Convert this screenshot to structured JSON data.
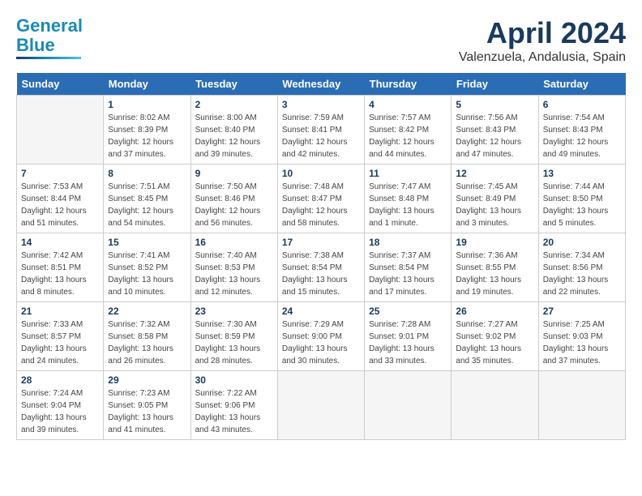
{
  "header": {
    "logo_line1": "General",
    "logo_line2": "Blue",
    "month": "April 2024",
    "location": "Valenzuela, Andalusia, Spain"
  },
  "days_of_week": [
    "Sunday",
    "Monday",
    "Tuesday",
    "Wednesday",
    "Thursday",
    "Friday",
    "Saturday"
  ],
  "weeks": [
    [
      {
        "num": "",
        "empty": true
      },
      {
        "num": "1",
        "sunrise": "8:02 AM",
        "sunset": "8:39 PM",
        "daylight": "12 hours and 37 minutes."
      },
      {
        "num": "2",
        "sunrise": "8:00 AM",
        "sunset": "8:40 PM",
        "daylight": "12 hours and 39 minutes."
      },
      {
        "num": "3",
        "sunrise": "7:59 AM",
        "sunset": "8:41 PM",
        "daylight": "12 hours and 42 minutes."
      },
      {
        "num": "4",
        "sunrise": "7:57 AM",
        "sunset": "8:42 PM",
        "daylight": "12 hours and 44 minutes."
      },
      {
        "num": "5",
        "sunrise": "7:56 AM",
        "sunset": "8:43 PM",
        "daylight": "12 hours and 47 minutes."
      },
      {
        "num": "6",
        "sunrise": "7:54 AM",
        "sunset": "8:43 PM",
        "daylight": "12 hours and 49 minutes."
      }
    ],
    [
      {
        "num": "7",
        "sunrise": "7:53 AM",
        "sunset": "8:44 PM",
        "daylight": "12 hours and 51 minutes."
      },
      {
        "num": "8",
        "sunrise": "7:51 AM",
        "sunset": "8:45 PM",
        "daylight": "12 hours and 54 minutes."
      },
      {
        "num": "9",
        "sunrise": "7:50 AM",
        "sunset": "8:46 PM",
        "daylight": "12 hours and 56 minutes."
      },
      {
        "num": "10",
        "sunrise": "7:48 AM",
        "sunset": "8:47 PM",
        "daylight": "12 hours and 58 minutes."
      },
      {
        "num": "11",
        "sunrise": "7:47 AM",
        "sunset": "8:48 PM",
        "daylight": "13 hours and 1 minute."
      },
      {
        "num": "12",
        "sunrise": "7:45 AM",
        "sunset": "8:49 PM",
        "daylight": "13 hours and 3 minutes."
      },
      {
        "num": "13",
        "sunrise": "7:44 AM",
        "sunset": "8:50 PM",
        "daylight": "13 hours and 5 minutes."
      }
    ],
    [
      {
        "num": "14",
        "sunrise": "7:42 AM",
        "sunset": "8:51 PM",
        "daylight": "13 hours and 8 minutes."
      },
      {
        "num": "15",
        "sunrise": "7:41 AM",
        "sunset": "8:52 PM",
        "daylight": "13 hours and 10 minutes."
      },
      {
        "num": "16",
        "sunrise": "7:40 AM",
        "sunset": "8:53 PM",
        "daylight": "13 hours and 12 minutes."
      },
      {
        "num": "17",
        "sunrise": "7:38 AM",
        "sunset": "8:54 PM",
        "daylight": "13 hours and 15 minutes."
      },
      {
        "num": "18",
        "sunrise": "7:37 AM",
        "sunset": "8:54 PM",
        "daylight": "13 hours and 17 minutes."
      },
      {
        "num": "19",
        "sunrise": "7:36 AM",
        "sunset": "8:55 PM",
        "daylight": "13 hours and 19 minutes."
      },
      {
        "num": "20",
        "sunrise": "7:34 AM",
        "sunset": "8:56 PM",
        "daylight": "13 hours and 22 minutes."
      }
    ],
    [
      {
        "num": "21",
        "sunrise": "7:33 AM",
        "sunset": "8:57 PM",
        "daylight": "13 hours and 24 minutes."
      },
      {
        "num": "22",
        "sunrise": "7:32 AM",
        "sunset": "8:58 PM",
        "daylight": "13 hours and 26 minutes."
      },
      {
        "num": "23",
        "sunrise": "7:30 AM",
        "sunset": "8:59 PM",
        "daylight": "13 hours and 28 minutes."
      },
      {
        "num": "24",
        "sunrise": "7:29 AM",
        "sunset": "9:00 PM",
        "daylight": "13 hours and 30 minutes."
      },
      {
        "num": "25",
        "sunrise": "7:28 AM",
        "sunset": "9:01 PM",
        "daylight": "13 hours and 33 minutes."
      },
      {
        "num": "26",
        "sunrise": "7:27 AM",
        "sunset": "9:02 PM",
        "daylight": "13 hours and 35 minutes."
      },
      {
        "num": "27",
        "sunrise": "7:25 AM",
        "sunset": "9:03 PM",
        "daylight": "13 hours and 37 minutes."
      }
    ],
    [
      {
        "num": "28",
        "sunrise": "7:24 AM",
        "sunset": "9:04 PM",
        "daylight": "13 hours and 39 minutes."
      },
      {
        "num": "29",
        "sunrise": "7:23 AM",
        "sunset": "9:05 PM",
        "daylight": "13 hours and 41 minutes."
      },
      {
        "num": "30",
        "sunrise": "7:22 AM",
        "sunset": "9:06 PM",
        "daylight": "13 hours and 43 minutes."
      },
      {
        "num": "",
        "empty": true
      },
      {
        "num": "",
        "empty": true
      },
      {
        "num": "",
        "empty": true
      },
      {
        "num": "",
        "empty": true
      }
    ]
  ],
  "labels": {
    "sunrise_prefix": "Sunrise: ",
    "sunset_prefix": "Sunset: ",
    "daylight_prefix": "Daylight: "
  }
}
